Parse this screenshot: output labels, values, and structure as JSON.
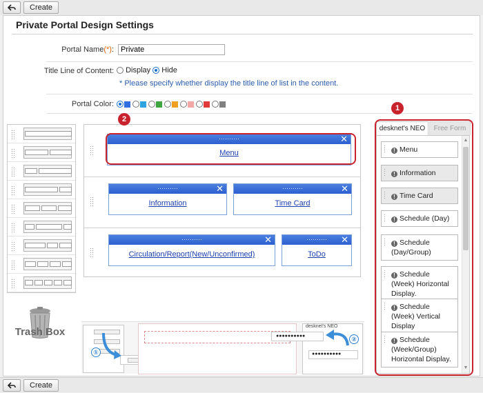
{
  "toolbar": {
    "create_label": "Create"
  },
  "page": {
    "title": "Private Portal Design Settings"
  },
  "form": {
    "portal_name_label": "Portal Name",
    "portal_name_req": "(*)",
    "portal_name_colon": ":",
    "portal_name_value": "Private",
    "title_line_label": "Title Line of Content",
    "title_line_colon": ":",
    "title_line_options": [
      "Display",
      "Hide"
    ],
    "title_line_selected": "Hide",
    "title_line_note": "* Please specify whether display the title line of list in the content.",
    "portal_color_label": "Portal Color",
    "portal_color_colon": ":",
    "portal_colors": [
      "#2f6fe0",
      "#2fa3e0",
      "#3fa53f",
      "#f0a020",
      "#f2a7a7",
      "#e03a3a",
      "#808080"
    ]
  },
  "canvas": {
    "widgets": [
      {
        "label": "Menu"
      },
      {
        "label": "Information"
      },
      {
        "label": "Time Card"
      },
      {
        "label": "Circulation/Report(New/Unconfirmed)"
      },
      {
        "label": "ToDo"
      }
    ]
  },
  "trash": {
    "label": "Trash Box"
  },
  "palette": {
    "tabs": [
      "desknet's NEO",
      "Free Form"
    ],
    "items": [
      {
        "label": "Menu"
      },
      {
        "label": "Information"
      },
      {
        "label": "Time Card"
      },
      {
        "label": "Schedule (Day)"
      },
      {
        "label": "Schedule (Day/Group)"
      },
      {
        "label": "Schedule (Week) Horizontal Display."
      },
      {
        "label": "Schedule (Week) Vertical Display"
      },
      {
        "label": "Schedule (Week/Group) Horizontal Display."
      }
    ]
  },
  "callouts": {
    "one": "1",
    "two": "2"
  },
  "guide": {
    "tab_label": "desknet's NEO",
    "step1": "①",
    "step2": "②",
    "placeholder_dots": "●●●●●●●●●●"
  }
}
